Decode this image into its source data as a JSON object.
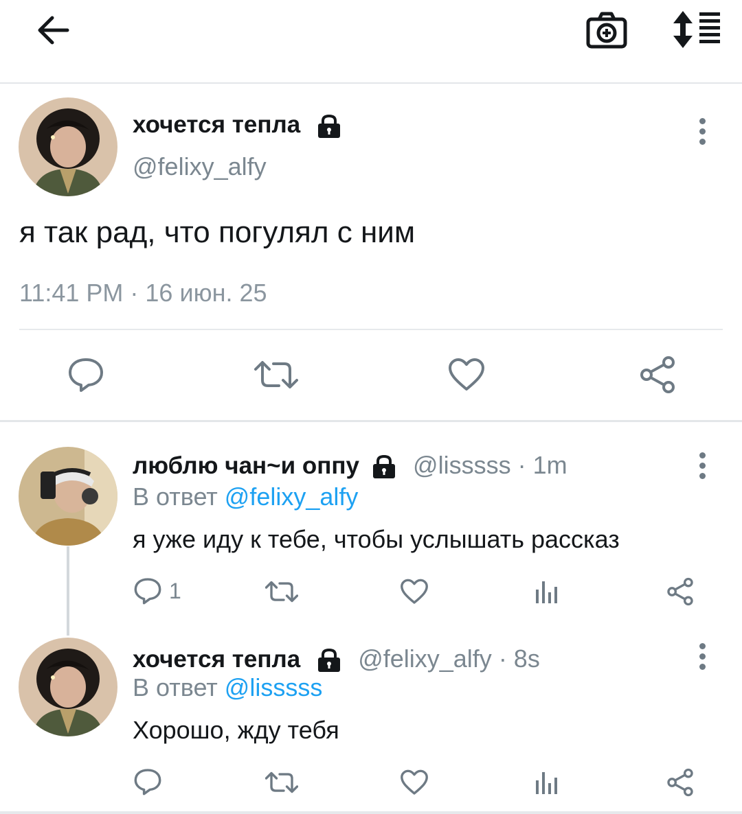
{
  "header": {
    "back_icon": "arrow-left-icon",
    "camera_icon": "camera-plus-icon",
    "sort_icon": "sort-list-icon"
  },
  "main_tweet": {
    "display_name": "хочется тепла",
    "handle": "@felixy_alfy",
    "text": "я так рад, что погулял с ним",
    "timestamp": "11:41 PM · 16 июн. 25",
    "icons": [
      "lock-icon",
      "more-vert-icon",
      "reply-icon",
      "retweet-icon",
      "like-icon",
      "share-icon"
    ]
  },
  "replies": [
    {
      "display_name": "люблю чан~и оппу",
      "handle_time": "@lisssss · 1m",
      "in_reply_prefix": "В ответ",
      "in_reply_to": "@felixy_alfy",
      "text": "я уже иду к тебе, чтобы услышать рассказ",
      "reply_count": "1"
    },
    {
      "display_name": "хочется тепла",
      "handle_time": "@felixy_alfy · 8s",
      "in_reply_prefix": "В ответ",
      "in_reply_to": "@lisssss",
      "text": "Хорошо, жду тебя",
      "reply_count": ""
    }
  ],
  "colors": {
    "accent": "#1da1f2",
    "icon_gray": "#6e7a84",
    "secondary_text": "#7b8790"
  }
}
